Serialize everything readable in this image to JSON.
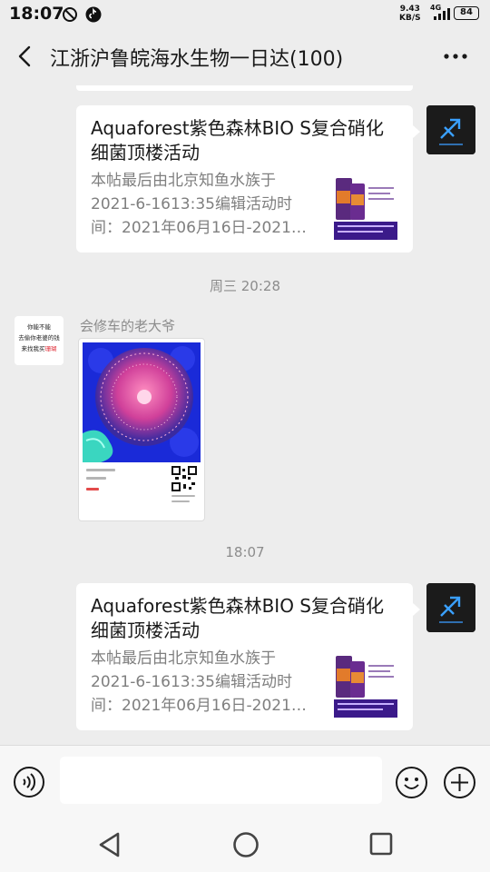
{
  "status_bar": {
    "time": "18:07",
    "net_speed_value": "9.43",
    "net_speed_unit": "KB/S",
    "network": "4G",
    "battery": "84"
  },
  "header": {
    "title": "江浙沪鲁皖海水生物一日达(100)",
    "back_icon": "chevron-left-icon",
    "more_icon": "ellipsis-icon"
  },
  "messages": [
    {
      "type": "link",
      "side": "right",
      "title": "Aquaforest紫色森林BIO S复合硝化细菌顶楼活动",
      "desc_lines": [
        "本帖最后由北京知鱼水族于",
        "2021-6-1613:35编辑活动时",
        "间：2021年06月16日-2021…"
      ]
    },
    {
      "type": "timestamp",
      "text": "周三 20:28"
    },
    {
      "type": "image",
      "side": "left",
      "sender": "会修车的老大爷",
      "avatar_lines": [
        "你能不能",
        "去偷你老婆的钱",
        "来找我买"
      ],
      "avatar_red": "珊瑚"
    },
    {
      "type": "timestamp",
      "text": "18:07"
    },
    {
      "type": "link",
      "side": "right",
      "title": "Aquaforest紫色森林BIO S复合硝化细菌顶楼活动",
      "desc_lines": [
        "本帖最后由北京知鱼水族于",
        "2021-6-1613:35编辑活动时",
        "间：2021年06月16日-2021…"
      ]
    }
  ],
  "input_bar": {
    "value": "",
    "voice_icon": "voice-icon",
    "emoji_icon": "emoji-icon",
    "plus_icon": "plus-icon"
  },
  "nav_bar": {
    "back_icon": "nav-back-icon",
    "home_icon": "nav-home-icon",
    "recent_icon": "nav-recent-icon"
  },
  "colors": {
    "background": "#ededed",
    "bubble": "#ffffff",
    "muted_text": "#8c8c8c"
  }
}
